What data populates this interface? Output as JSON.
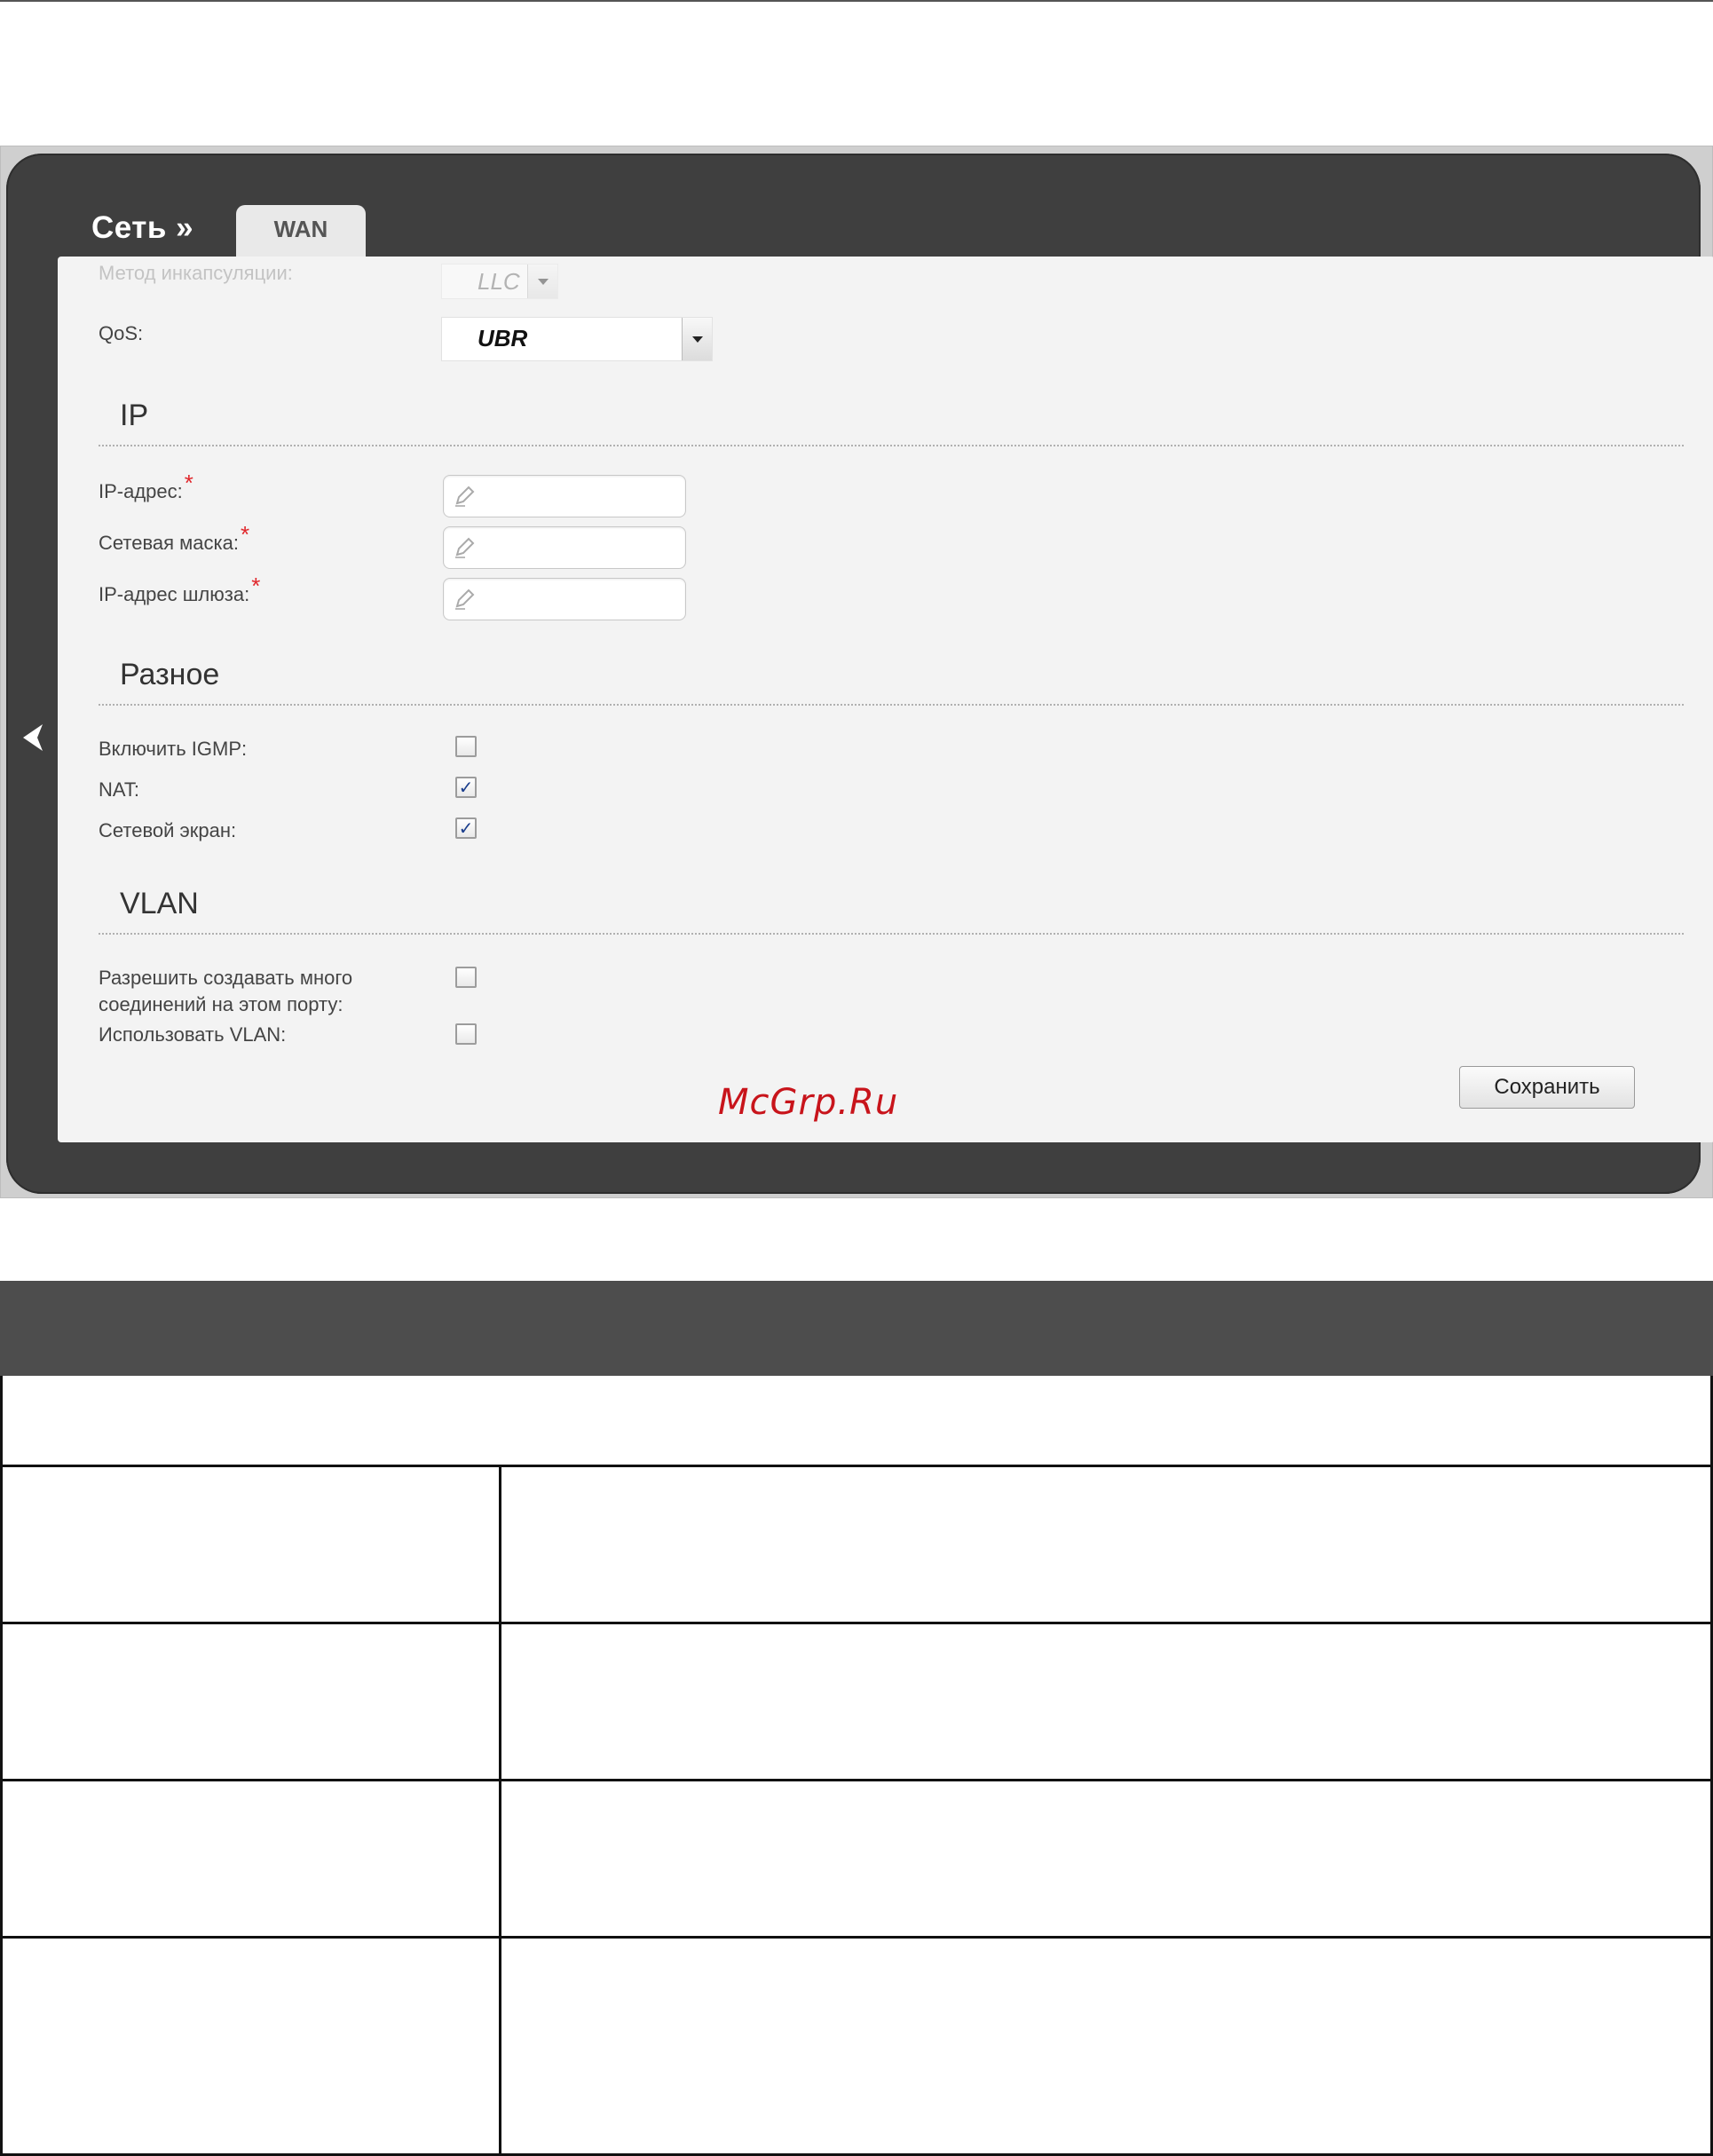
{
  "breadcrumb": {
    "section": "Сеть »",
    "tab": "WAN"
  },
  "form": {
    "encapsulation_label": "Метод инкапсуляции:",
    "encapsulation_value": "LLC",
    "qos_label": "QoS:",
    "qos_value": "UBR",
    "ip_section": "IP",
    "ip_address_label": "IP-адрес:",
    "netmask_label": "Сетевая маска:",
    "gateway_label": "IP-адрес шлюза:",
    "required_mark": "*",
    "misc_section": "Разное",
    "igmp_label": "Включить IGMP:",
    "igmp_checked": false,
    "nat_label": "NAT:",
    "nat_checked": true,
    "firewall_label": "Сетевой экран:",
    "firewall_checked": true,
    "vlan_section": "VLAN",
    "multi_conn_label_line1": "Разрешить создавать много",
    "multi_conn_label_line2": "соединений на этом порту:",
    "multi_conn_checked": false,
    "use_vlan_label": "Использовать VLAN:",
    "use_vlan_checked": false,
    "save_button": "Сохранить"
  },
  "watermark": "McGrp.Ru",
  "colors": {
    "frame": "#3f3f3f",
    "panel": "#f3f3f3",
    "required": "#e0262b",
    "watermark": "#c8141b",
    "table_header": "#4d4d4d"
  },
  "icons": {
    "back": "chevron-left-icon",
    "input": "pencil-icon"
  }
}
